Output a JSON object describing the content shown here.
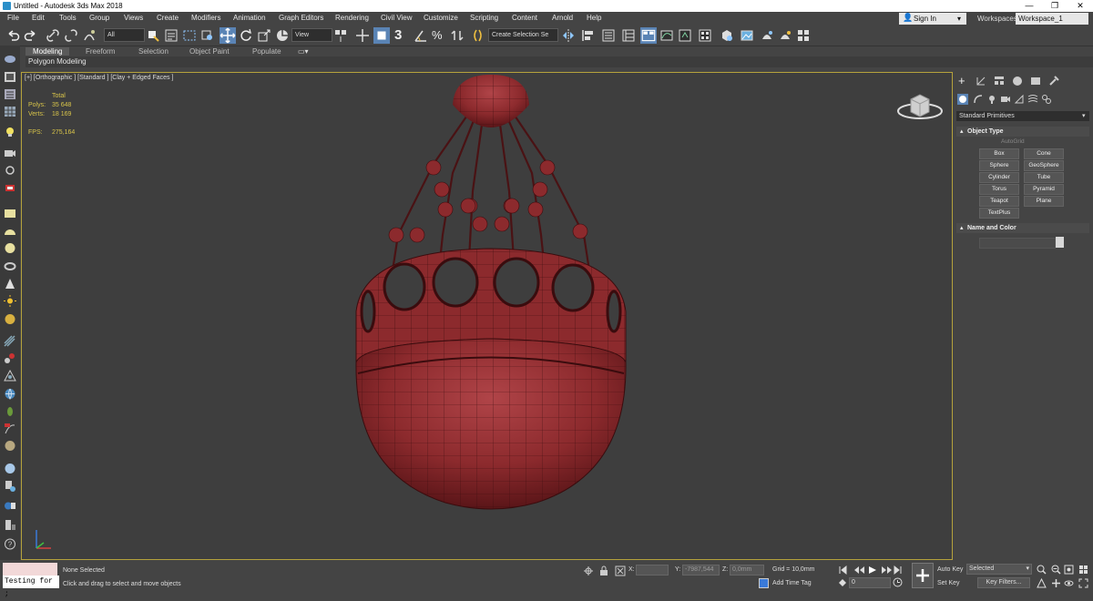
{
  "window": {
    "title": "Untitled - Autodesk 3ds Max 2018",
    "minimize": "—",
    "maximize": "❐",
    "close": "✕"
  },
  "menubar": {
    "items": [
      "File",
      "Edit",
      "Tools",
      "Group",
      "Views",
      "Create",
      "Modifiers",
      "Animation",
      "Graph Editors",
      "Rendering",
      "Civil View",
      "Customize",
      "Scripting",
      "Content",
      "Arnold",
      "Help"
    ],
    "signin": "Sign In",
    "workspaces_label": "Workspaces:",
    "workspace_value": "Workspace_1"
  },
  "toolbar": {
    "selection_filter": "All",
    "ref_coord": "View",
    "named_selection_placeholder": "Create Selection Se",
    "snap_label": "3"
  },
  "ribbon": {
    "tabs": [
      "Modeling",
      "Freeform",
      "Selection",
      "Object Paint",
      "Populate"
    ],
    "active_tab": "Modeling",
    "subpanel": "Polygon Modeling"
  },
  "viewport": {
    "label": "[+] [Orthographic ] [Standard ] [Clay + Edged Faces ]",
    "stats": {
      "total": "Total",
      "polys_label": "Polys:",
      "polys": "35 648",
      "verts_label": "Verts:",
      "verts": "18 169",
      "fps_label": "FPS:",
      "fps": "275,164"
    },
    "model_color": "#8c2a2d"
  },
  "command_panel": {
    "category": "Standard Primitives",
    "object_type_title": "Object Type",
    "autogrid": "AutoGrid",
    "buttons": [
      "Box",
      "Cone",
      "Sphere",
      "GeoSphere",
      "Cylinder",
      "Tube",
      "Torus",
      "Pyramid",
      "Teapot",
      "Plane",
      "TextPlus"
    ],
    "name_color_title": "Name and Color"
  },
  "statusbar": {
    "script_listener": "Testing for ;",
    "selection_status": "None Selected",
    "prompt": "Click and drag to select and move objects",
    "x_label": "X:",
    "y_label": "Y:",
    "y_value": "-7987,544",
    "z_label": "Z:",
    "z_value": "0,0mm",
    "grid": "Grid = 10,0mm",
    "add_time_tag": "Add Time Tag",
    "frame": "0",
    "auto_key": "Auto Key",
    "set_key": "Set Key",
    "selected": "Selected",
    "key_filters": "Key Filters..."
  }
}
